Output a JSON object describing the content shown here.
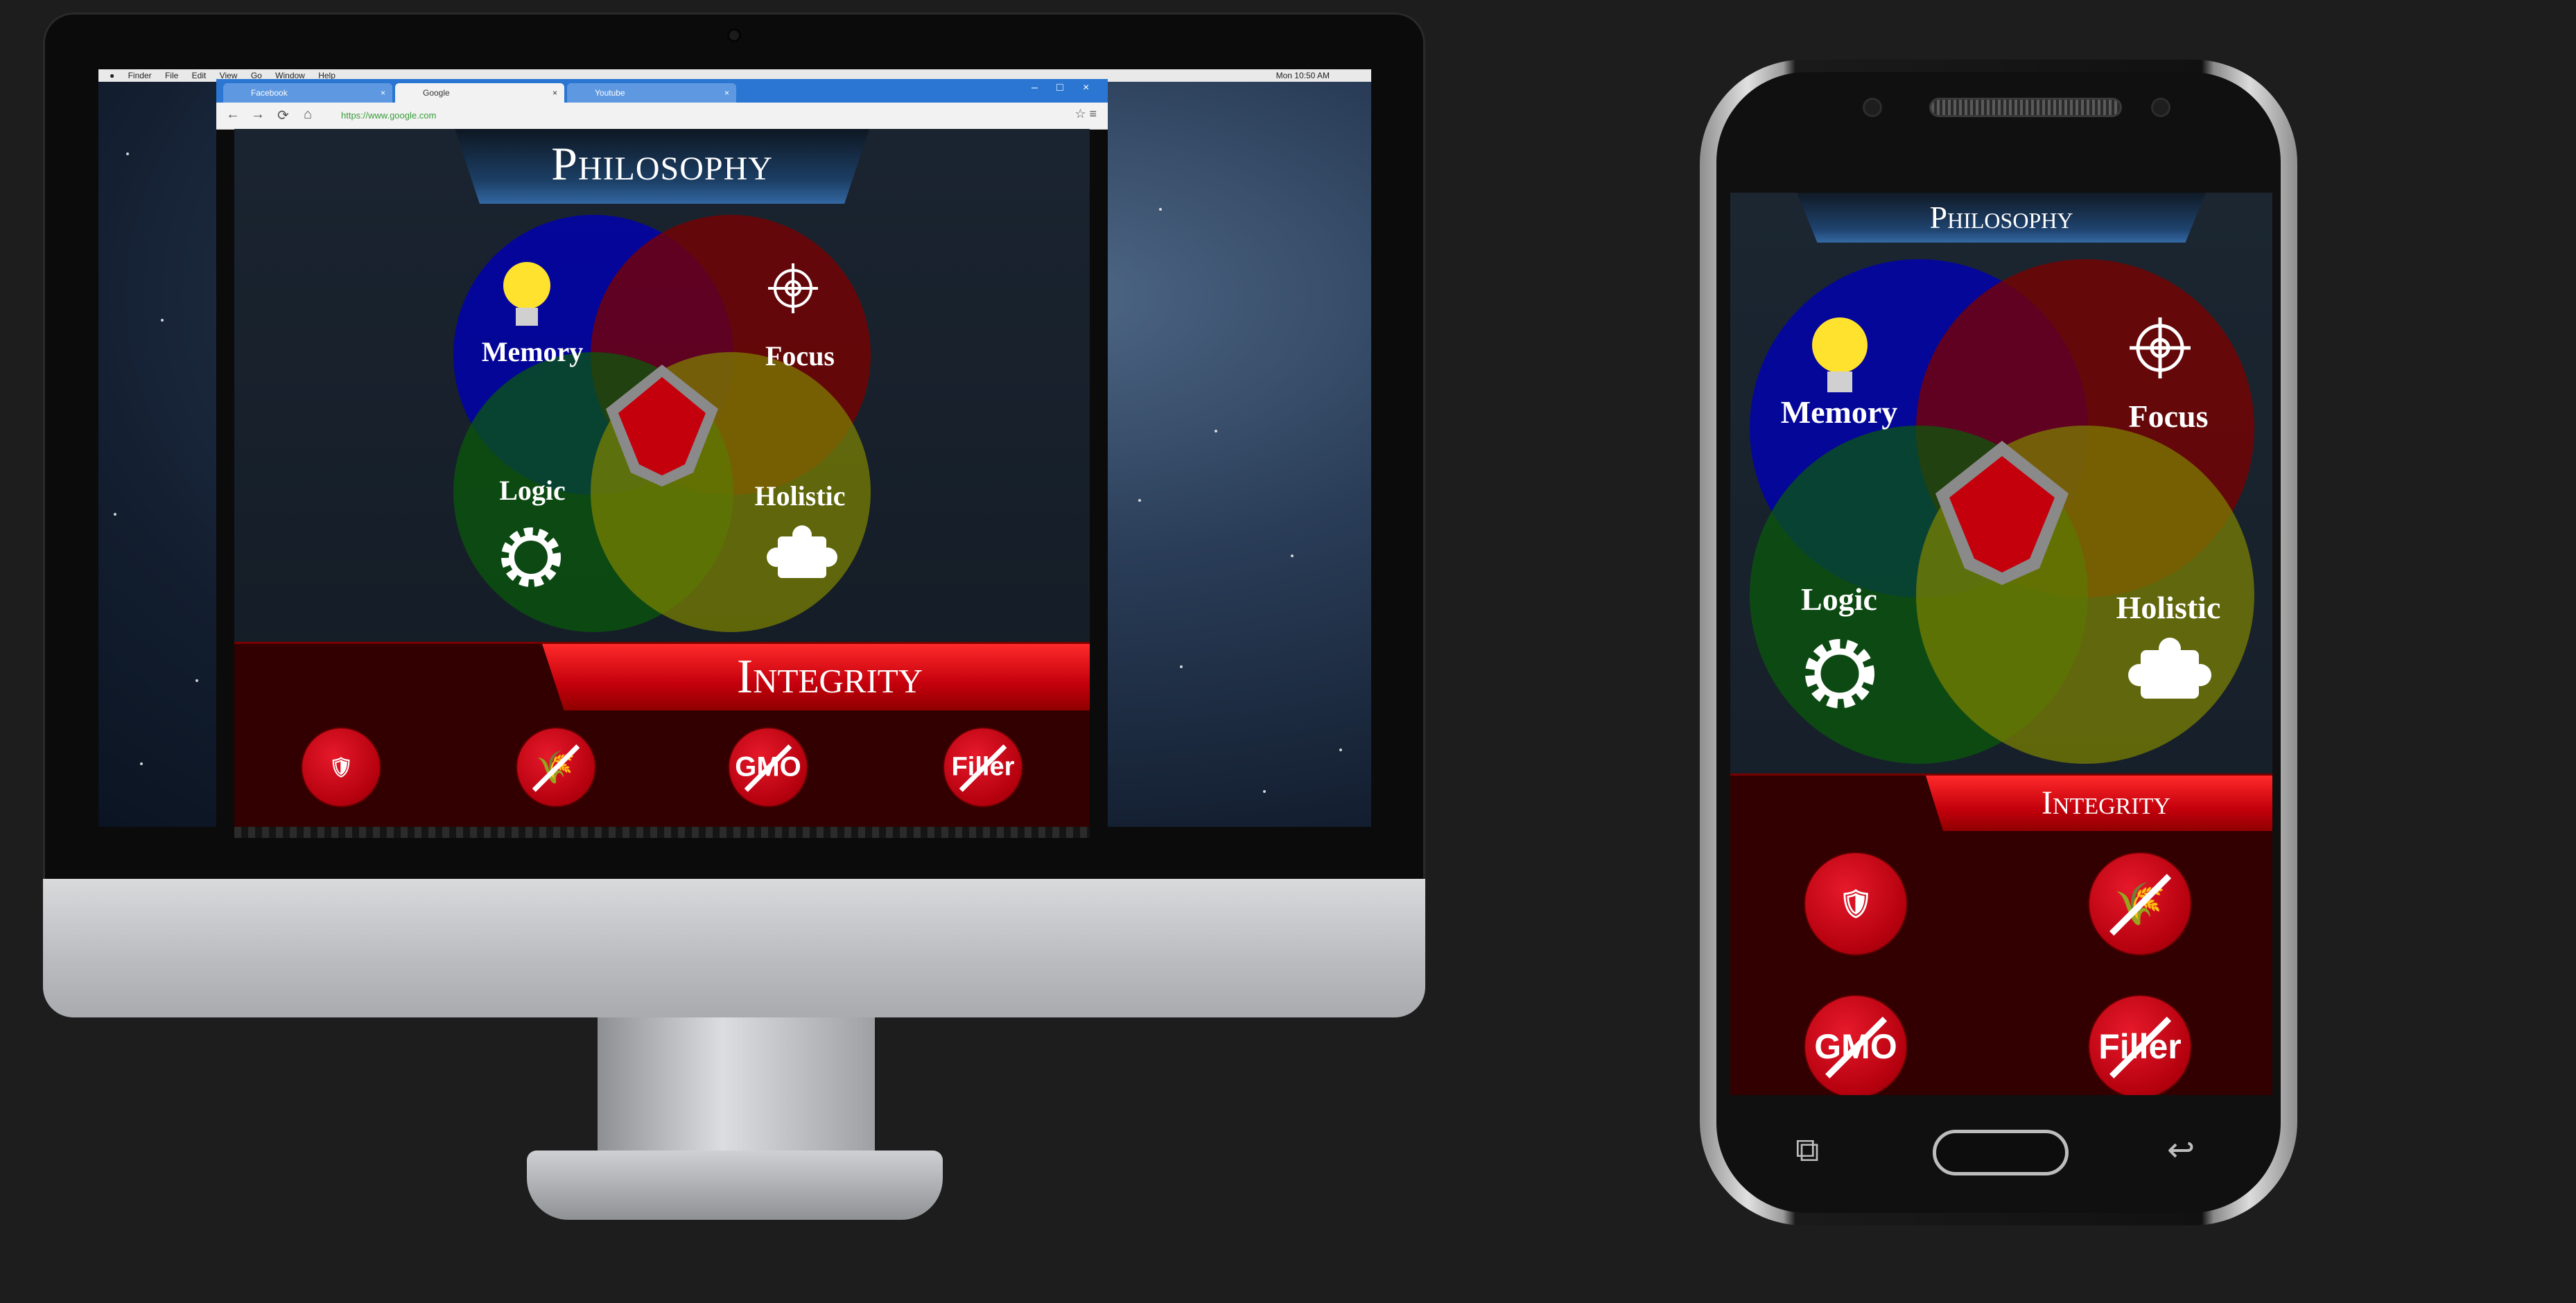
{
  "mac_menubar": {
    "apple": "",
    "items": [
      "Finder",
      "File",
      "Edit",
      "View",
      "Go",
      "Window",
      "Help"
    ],
    "clock": "Mon 10:50 AM"
  },
  "browser": {
    "tabs": [
      {
        "label": "Facebook",
        "active": false
      },
      {
        "label": "Google",
        "active": true
      },
      {
        "label": "Youtube",
        "active": false
      }
    ],
    "url": "https://www.google.com"
  },
  "site": {
    "title": "Philosophy",
    "venn": {
      "circles": [
        {
          "label": "Memory",
          "icon": "lightbulb-icon",
          "color": "#0000b4"
        },
        {
          "label": "Focus",
          "icon": "crosshair-icon",
          "color": "#7a0000"
        },
        {
          "label": "Logic",
          "icon": "gear-icon",
          "color": "#0a5a0a"
        },
        {
          "label": "Holistic",
          "icon": "puzzle-icon",
          "color": "#7d8200"
        }
      ],
      "center_icon": "lion-crest-icon"
    },
    "integrity": {
      "title": "Integrity",
      "badges": [
        {
          "label": "",
          "icon": "made-in-usa-icon"
        },
        {
          "label": "",
          "icon": "no-gluten-icon"
        },
        {
          "label": "GMO",
          "icon": "no-gmo-icon"
        },
        {
          "label": "Filler",
          "icon": "no-filler-icon"
        }
      ]
    }
  },
  "colors": {
    "background": "#1d1d1d",
    "integrity_bg": "#320000",
    "ribbon_red": "#d8000e",
    "title_plate_blue": "#1c3f66"
  }
}
